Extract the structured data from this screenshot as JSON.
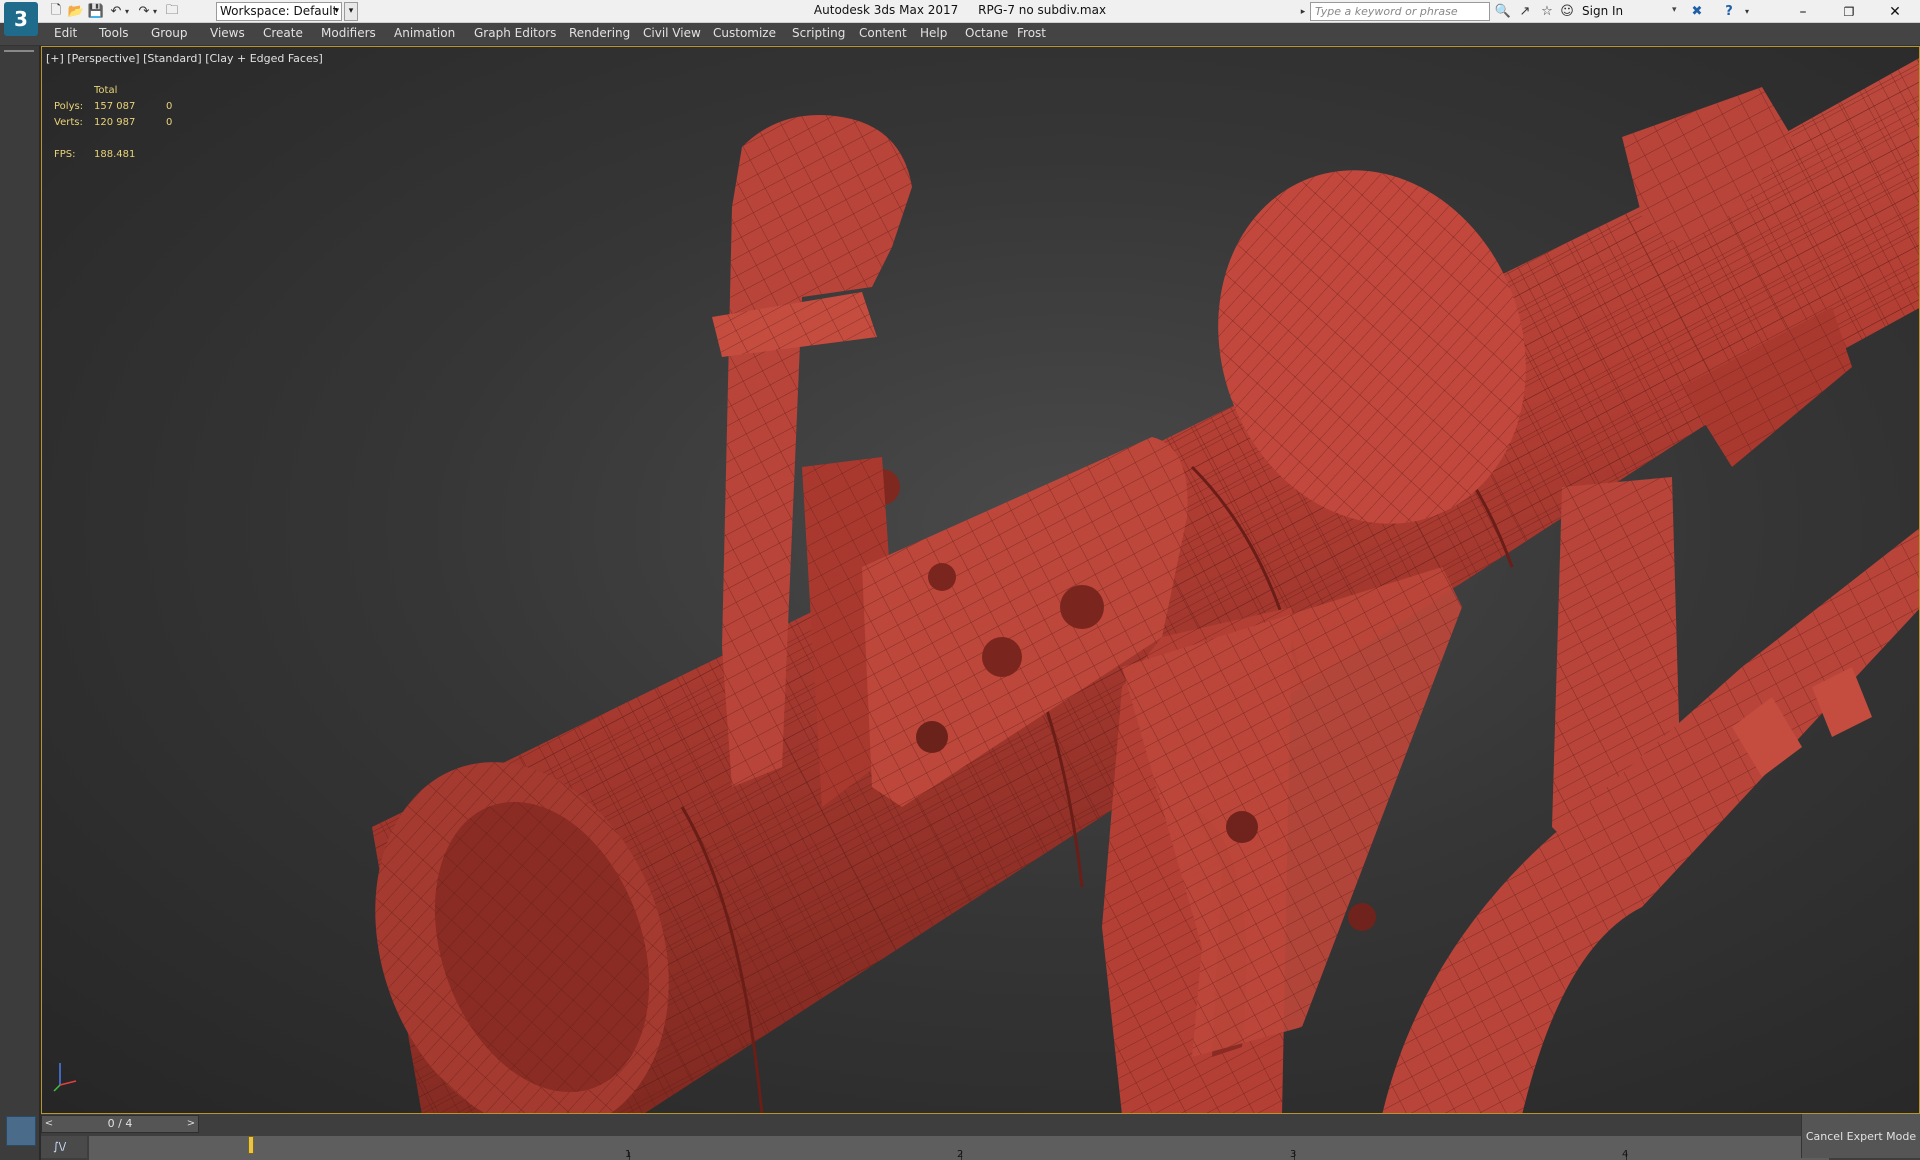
{
  "app": {
    "title": "Autodesk 3ds Max 2017",
    "filename": "RPG-7 no subdiv.max",
    "logo": "3"
  },
  "toolbar": {
    "workspace_label": "Workspace: Default",
    "search_placeholder": "Type a keyword or phrase",
    "sign_in": "Sign In"
  },
  "menu": {
    "items": [
      "Edit",
      "Tools",
      "Group",
      "Views",
      "Create",
      "Modifiers",
      "Animation",
      "Graph Editors",
      "Rendering",
      "Civil View",
      "Customize",
      "Scripting",
      "Content",
      "Help",
      "Octane",
      "Frost"
    ]
  },
  "viewport": {
    "label": "[+] [Perspective] [Standard] [Clay + Edged Faces]",
    "stats": {
      "header": "Total",
      "polys_label": "Polys:",
      "polys_total": "157 087",
      "polys_sel": "0",
      "verts_label": "Verts:",
      "verts_total": "120 987",
      "verts_sel": "0",
      "fps_label": "FPS:",
      "fps_value": "188.481"
    },
    "model_color": "#b8443a",
    "highlight_color": "#b8962c"
  },
  "bottom": {
    "frame_counter": "0 / 4",
    "curve_editor_label": "∫\\/",
    "ticks": [
      "1",
      "2",
      "3",
      "4"
    ],
    "cancel_expert": "Cancel Expert Mode"
  }
}
